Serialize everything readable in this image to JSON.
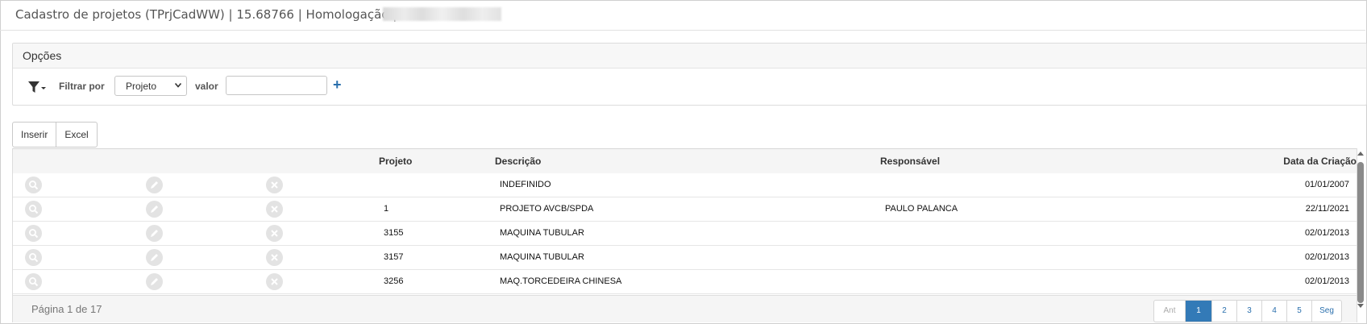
{
  "title": "Cadastro de projetos (TPrjCadWW) | 15.68766 | Homologação |",
  "options": {
    "header": "Opções",
    "filter_icon": "filter-dropdown-icon",
    "filter_label": "Filtrar por",
    "filter_select_value": "Projeto",
    "valor_label": "valor",
    "valor_value": "",
    "add_label": "+"
  },
  "toolbar": {
    "insert_label": "Inserir",
    "excel_label": "Excel"
  },
  "table": {
    "headers": {
      "projeto": "Projeto",
      "descricao": "Descrição",
      "responsavel": "Responsável",
      "data": "Data da Criação"
    },
    "row_icons": [
      "search-icon",
      "edit-icon",
      "delete-icon"
    ],
    "rows": [
      {
        "projeto": "",
        "descricao": "INDEFINIDO",
        "responsavel": "",
        "data": "01/01/2007"
      },
      {
        "projeto": "1",
        "descricao": "PROJETO AVCB/SPDA",
        "responsavel": "PAULO PALANCA",
        "data": "22/11/2021"
      },
      {
        "projeto": "3155",
        "descricao": "MAQUINA TUBULAR",
        "responsavel": "",
        "data": "02/01/2013"
      },
      {
        "projeto": "3157",
        "descricao": "MAQUINA TUBULAR",
        "responsavel": "",
        "data": "02/01/2013"
      },
      {
        "projeto": "3256",
        "descricao": "MAQ.TORCEDEIRA CHINESA",
        "responsavel": "",
        "data": "02/01/2013"
      }
    ]
  },
  "pagination": {
    "info": "Página 1 de 17",
    "prev": "Ant",
    "pages": [
      "1",
      "2",
      "3",
      "4",
      "5"
    ],
    "current": "1",
    "next": "Seg"
  },
  "colors": {
    "accent": "#337ab7",
    "header_bg": "#f5f5f5",
    "icon_circle": "#e3e3e3"
  }
}
